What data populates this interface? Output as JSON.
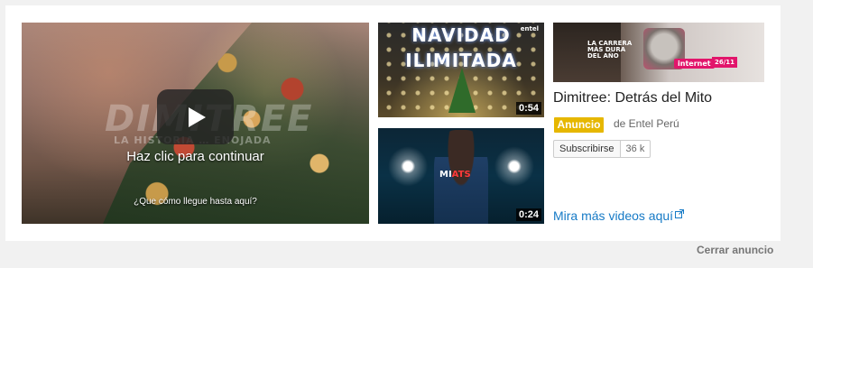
{
  "main_video": {
    "overlay_brand": "DIMITREE",
    "overlay_tagline": "LA HISTORIA … ENOJADA",
    "click_to_continue": "Haz clic para continuar",
    "subtitle": "¿Que cómo llegue hasta aquí?"
  },
  "thumbnails": [
    {
      "title_line1": "NAVIDAD",
      "title_line2": "ILIMITADA",
      "corner_logo": "entel",
      "duration": "0:54"
    },
    {
      "art_text_prefix": "MI",
      "art_text_highlight": "ATS",
      "duration": "0:24"
    }
  ],
  "channel": {
    "banner_badge_lines": [
      "LA CARRERA",
      "MÁS DURA",
      "DEL AÑO"
    ],
    "banner_pill": "internet",
    "banner_date": "26/11",
    "name": "Dimitree: Detrás del Mito",
    "ad_badge": "Anuncio",
    "byline": "de Entel Perú",
    "subscribe_label": "Subscribirse",
    "subscriber_count": "36 k",
    "more_videos_link": "Mira más videos aquí"
  },
  "close_ad": "Cerrar anuncio",
  "colors": {
    "ad_badge": "#e6b700",
    "link": "#167ac6",
    "band_bg": "#f1f1f1"
  },
  "icons": {
    "play": "play-icon",
    "external": "external-link-icon"
  }
}
